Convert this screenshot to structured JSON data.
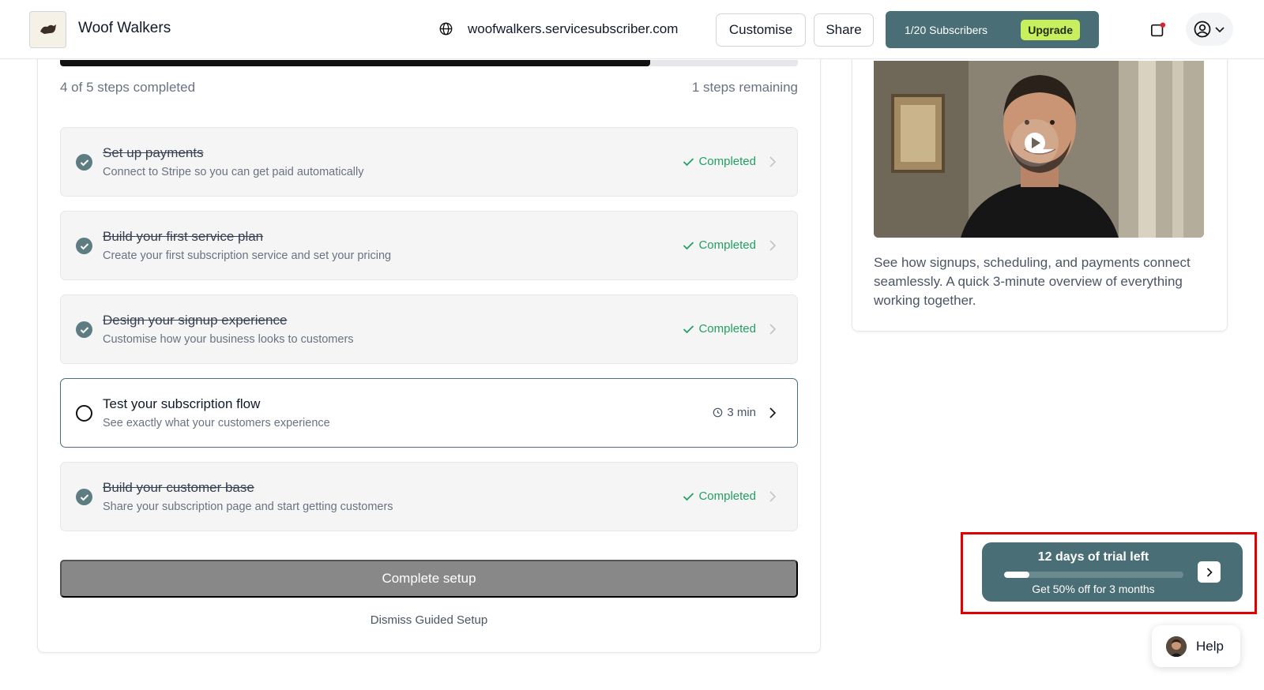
{
  "header": {
    "brand": "Woof Walkers",
    "logo_text": "Woof Walkers",
    "domain": "woofwalkers.servicesubscriber.com",
    "customise_label": "Customise",
    "share_label": "Share",
    "subscribers_label": "1/20 Subscribers",
    "upgrade_label": "Upgrade"
  },
  "setup": {
    "progress_fraction": 0.8,
    "steps_completed_text": "4 of 5 steps completed",
    "steps_remaining_text": "1 steps remaining",
    "steps": [
      {
        "title": "Set up payments",
        "description": "Connect to Stripe so you can get paid automatically",
        "status": "Completed",
        "done": true
      },
      {
        "title": "Build your first service plan",
        "description": "Create your first subscription service and set your pricing",
        "status": "Completed",
        "done": true
      },
      {
        "title": "Design your signup experience",
        "description": "Customise how your business looks to customers",
        "status": "Completed",
        "done": true
      },
      {
        "title": "Test your subscription flow",
        "description": "See exactly what your customers experience",
        "status": "3 min",
        "done": false
      },
      {
        "title": "Build your customer base",
        "description": "Share your subscription page and start getting customers",
        "status": "Completed",
        "done": true
      }
    ],
    "complete_button": "Complete setup",
    "dismiss_link": "Dismiss Guided Setup"
  },
  "video_card": {
    "description": "See how signups, scheduling, and payments connect seamlessly. A quick 3-minute overview of everything working together."
  },
  "trial": {
    "title": "12 days of trial left",
    "offer": "Get 50% off for 3 months",
    "progress_fraction": 0.14
  },
  "help": {
    "label": "Help"
  },
  "colors": {
    "accent": "#4a6e75",
    "upgrade": "#c8ef5e",
    "completed_green": "#22a163",
    "highlight_red": "#e00000"
  }
}
